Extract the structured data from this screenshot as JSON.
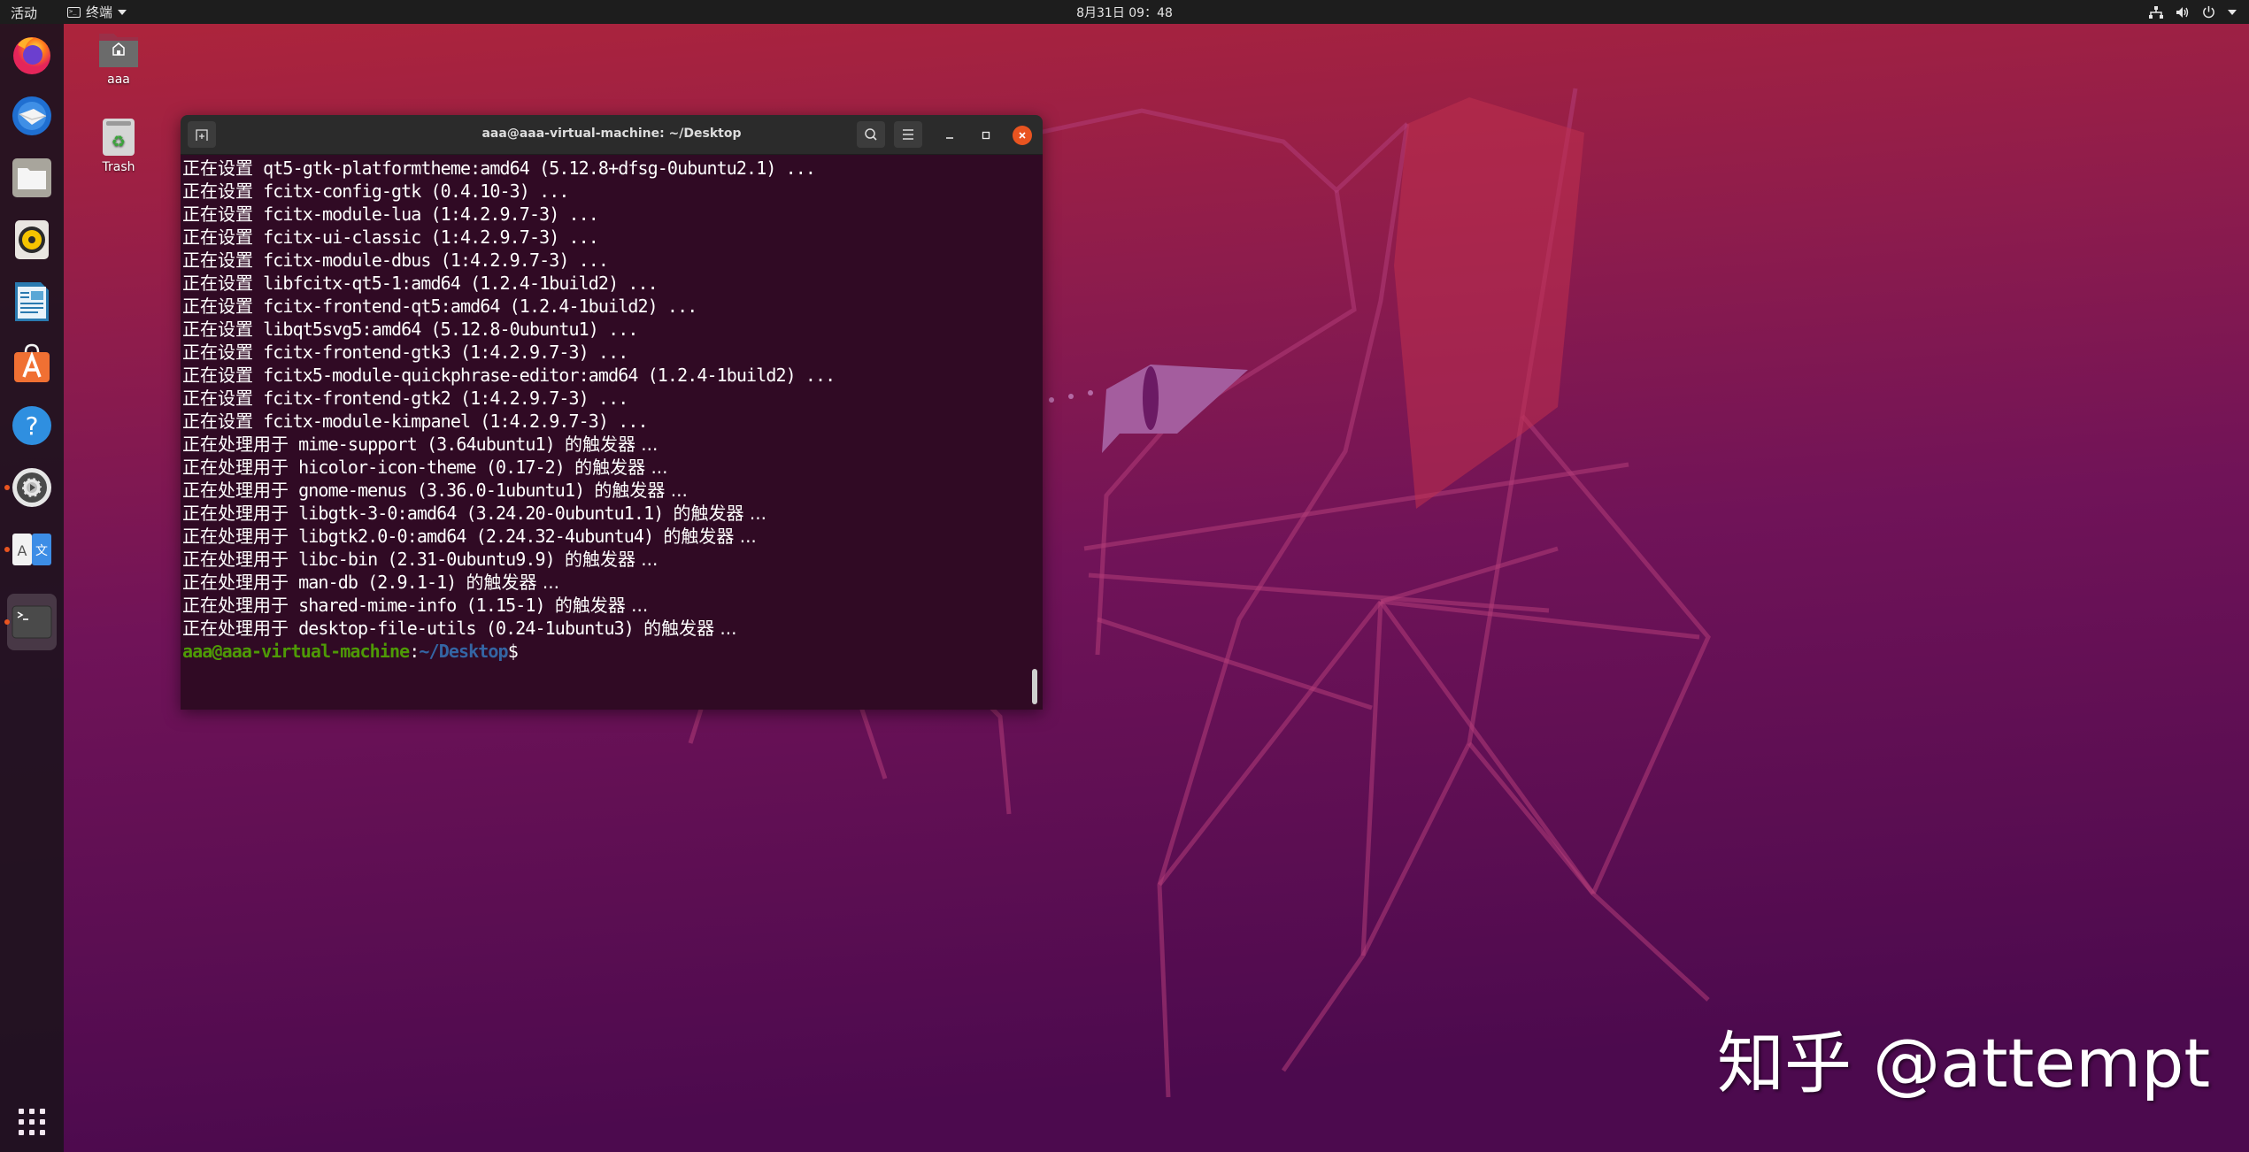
{
  "topbar": {
    "activities_label": "活动",
    "app_menu_label": "终端",
    "clock": "8月31日  09：48",
    "tray_icons": [
      "network-icon",
      "volume-icon",
      "power-icon",
      "system-menu-caret-icon"
    ]
  },
  "dock": {
    "items": [
      {
        "name": "firefox",
        "icon": "firefox-icon",
        "running": false
      },
      {
        "name": "thunderbird",
        "icon": "thunderbird-mail-icon",
        "running": false
      },
      {
        "name": "files",
        "icon": "files-folder-icon",
        "running": false
      },
      {
        "name": "rhythmbox",
        "icon": "rhythmbox-speaker-icon",
        "running": false
      },
      {
        "name": "libreoffice-writer",
        "icon": "libreoffice-writer-icon",
        "running": false
      },
      {
        "name": "ubuntu-software",
        "icon": "ubuntu-software-bag-icon",
        "running": false
      },
      {
        "name": "help",
        "icon": "help-question-icon",
        "running": false
      },
      {
        "name": "software-updater",
        "icon": "software-updater-gear-icon",
        "running": true
      },
      {
        "name": "language-support",
        "icon": "language-support-icon",
        "running": true
      },
      {
        "name": "terminal",
        "icon": "terminal-icon",
        "running": true,
        "active": true
      }
    ],
    "show_apps_icon": "show-applications-grid-icon"
  },
  "desktop": {
    "icons": [
      {
        "label": "aaa",
        "icon": "home-folder-icon"
      },
      {
        "label": "Trash",
        "icon": "trash-icon"
      }
    ]
  },
  "terminal": {
    "title": "aaa@aaa-virtual-machine: ~/Desktop",
    "lines": [
      {
        "prefix": "正在设置",
        "text": " qt5-gtk-platformtheme:amd64 (5.12.8+dfsg-0ubuntu2.1) ...",
        "suffix": ""
      },
      {
        "prefix": "正在设置",
        "text": " fcitx-config-gtk (0.4.10-3) ...",
        "suffix": ""
      },
      {
        "prefix": "正在设置",
        "text": " fcitx-module-lua (1:4.2.9.7-3) ...",
        "suffix": ""
      },
      {
        "prefix": "正在设置",
        "text": " fcitx-ui-classic (1:4.2.9.7-3) ...",
        "suffix": ""
      },
      {
        "prefix": "正在设置",
        "text": " fcitx-module-dbus (1:4.2.9.7-3) ...",
        "suffix": ""
      },
      {
        "prefix": "正在设置",
        "text": " libfcitx-qt5-1:amd64 (1.2.4-1build2) ...",
        "suffix": ""
      },
      {
        "prefix": "正在设置",
        "text": " fcitx-frontend-qt5:amd64 (1.2.4-1build2) ...",
        "suffix": ""
      },
      {
        "prefix": "正在设置",
        "text": " libqt5svg5:amd64 (5.12.8-0ubuntu1) ...",
        "suffix": ""
      },
      {
        "prefix": "正在设置",
        "text": " fcitx-frontend-gtk3 (1:4.2.9.7-3) ...",
        "suffix": ""
      },
      {
        "prefix": "正在设置",
        "text": " fcitx5-module-quickphrase-editor:amd64 (1.2.4-1build2) ...",
        "suffix": ""
      },
      {
        "prefix": "正在设置",
        "text": " fcitx-frontend-gtk2 (1:4.2.9.7-3) ...",
        "suffix": ""
      },
      {
        "prefix": "正在设置",
        "text": " fcitx-module-kimpanel (1:4.2.9.7-3) ...",
        "suffix": ""
      },
      {
        "prefix": "正在处理用于",
        "text": " mime-support (3.64ubuntu1) ",
        "suffix": "的触发器 ..."
      },
      {
        "prefix": "正在处理用于",
        "text": " hicolor-icon-theme (0.17-2) ",
        "suffix": "的触发器 ..."
      },
      {
        "prefix": "正在处理用于",
        "text": " gnome-menus (3.36.0-1ubuntu1) ",
        "suffix": "的触发器 ..."
      },
      {
        "prefix": "正在处理用于",
        "text": " libgtk-3-0:amd64 (3.24.20-0ubuntu1.1) ",
        "suffix": "的触发器 ..."
      },
      {
        "prefix": "正在处理用于",
        "text": " libgtk2.0-0:amd64 (2.24.32-4ubuntu4) ",
        "suffix": "的触发器 ..."
      },
      {
        "prefix": "正在处理用于",
        "text": " libc-bin (2.31-0ubuntu9.9) ",
        "suffix": "的触发器 ..."
      },
      {
        "prefix": "正在处理用于",
        "text": " man-db (2.9.1-1) ",
        "suffix": "的触发器 ..."
      },
      {
        "prefix": "正在处理用于",
        "text": " shared-mime-info (1.15-1) ",
        "suffix": "的触发器 ..."
      },
      {
        "prefix": "正在处理用于",
        "text": " desktop-file-utils (0.24-1ubuntu3) ",
        "suffix": "的触发器 ..."
      }
    ],
    "prompt": {
      "user_host": "aaa@aaa-virtual-machine",
      "separator": ":",
      "path": "~/Desktop",
      "symbol": "$"
    }
  },
  "watermark": "知乎 @attempt",
  "colors": {
    "accent": "#e95420",
    "terminal_bg": "#300a24",
    "prompt_user": "#4e9a06",
    "prompt_path": "#3465a4"
  }
}
